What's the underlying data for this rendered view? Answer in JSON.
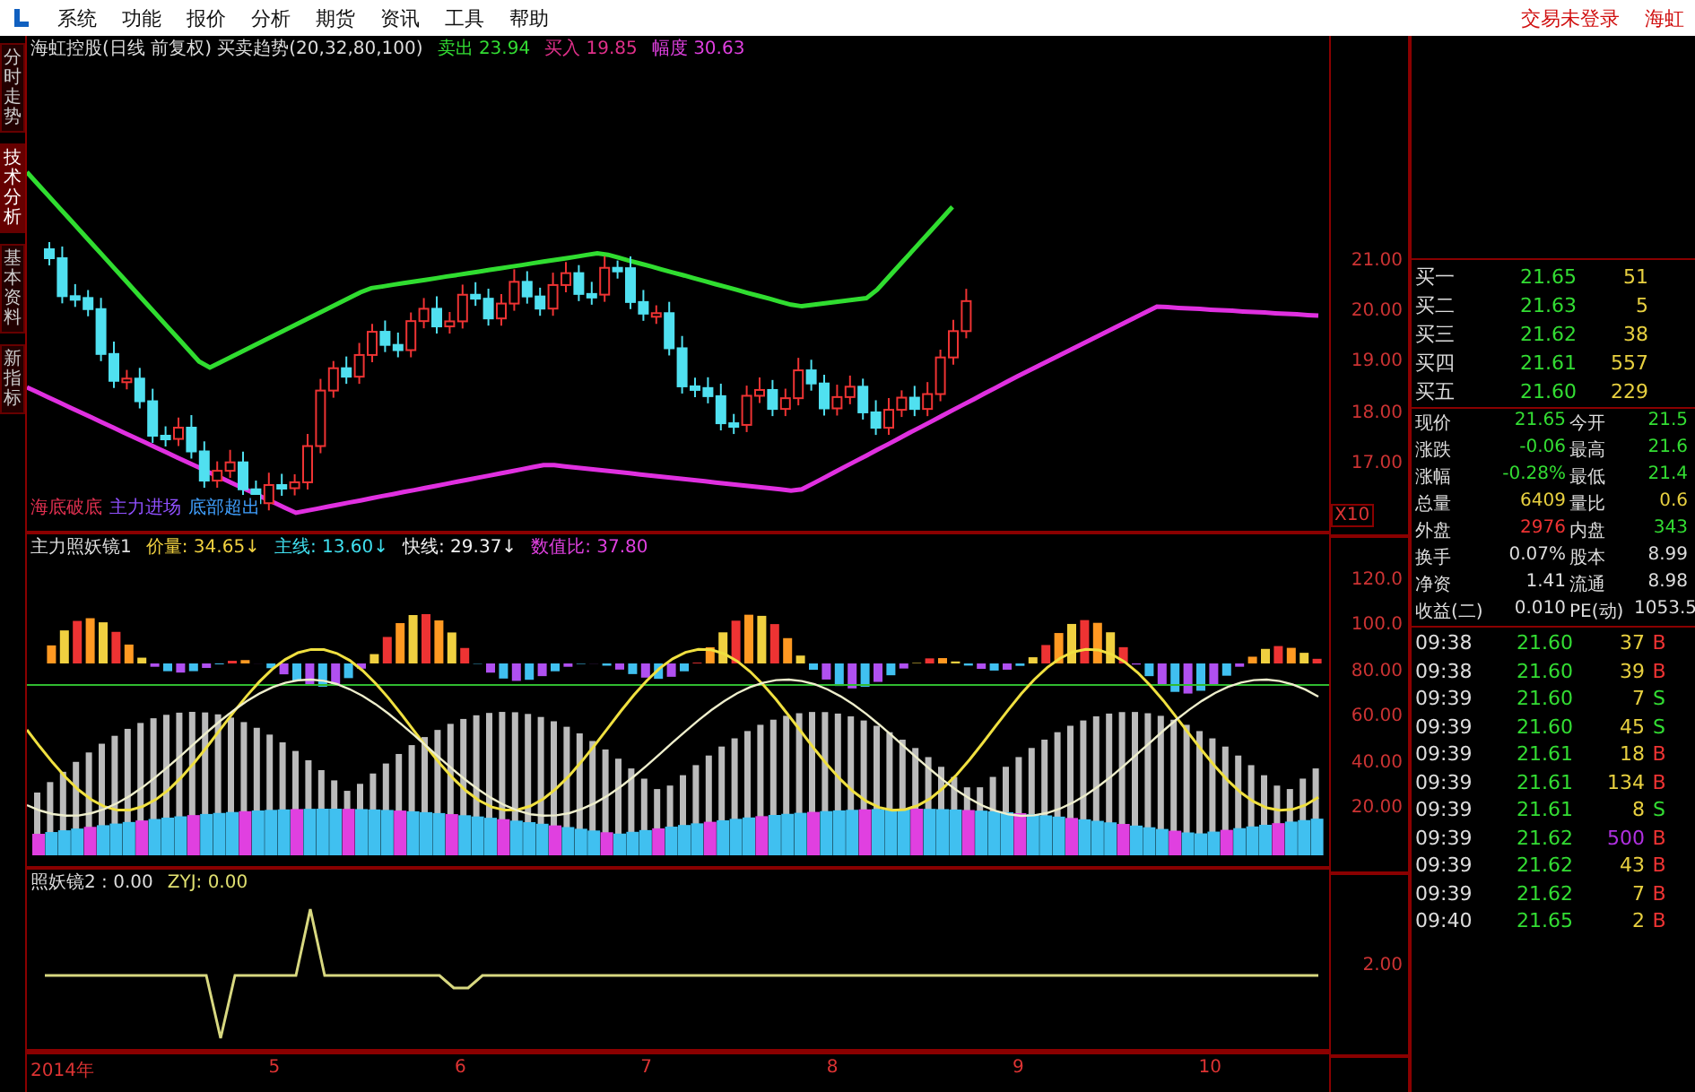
{
  "menu": {
    "items": [
      "系统",
      "功能",
      "报价",
      "分析",
      "期货",
      "资讯",
      "工具",
      "帮助"
    ],
    "login_status": "交易未登录",
    "stock_name": "海虹"
  },
  "side_tabs": [
    {
      "label": "分时走势",
      "selected": false
    },
    {
      "label": "技术分析",
      "selected": true
    },
    {
      "label": "基本资料",
      "selected": false
    },
    {
      "label": "新指标",
      "selected": false
    }
  ],
  "price_panel": {
    "title": "海虹控股(日线 前复权) 买卖趋势(20,32,80,100)",
    "readings": [
      {
        "text": "卖出 23.94",
        "color": "#33dd33"
      },
      {
        "text": "买入 19.85",
        "color": "#e0308a"
      },
      {
        "text": "幅度 30.63",
        "color": "#e040e0"
      }
    ],
    "signals": [
      {
        "text": "海底破底",
        "color": "#e03050"
      },
      {
        "text": "主力进场",
        "color": "#9050ff"
      },
      {
        "text": "底部超出",
        "color": "#40a0ff"
      }
    ],
    "axis_ticks": [
      "21.00",
      "20.00",
      "19.00",
      "18.00",
      "17.00"
    ],
    "scale": "X10"
  },
  "indicator_panel": {
    "title": "主力照妖镜1",
    "readings": [
      {
        "text": "价量: 34.65↓",
        "color": "#f0d040"
      },
      {
        "text": "主线: 13.60↓",
        "color": "#40e0f0"
      },
      {
        "text": "快线: 29.37↓",
        "color": "#f0f0f0"
      },
      {
        "text": "数值比: 37.80",
        "color": "#e040e0"
      }
    ],
    "axis_ticks": [
      "120.0",
      "100.0",
      "80.00",
      "60.00",
      "40.00",
      "20.00"
    ]
  },
  "lower_panel": {
    "readings": [
      {
        "text": "照妖镜2 : 0.00",
        "color": "#dddddd"
      },
      {
        "text": "ZYJ: 0.00",
        "color": "#e0e070"
      }
    ],
    "axis_ticks": [
      "2.00"
    ]
  },
  "x_axis": [
    "2014年",
    "5",
    "6",
    "7",
    "8",
    "9",
    "10"
  ],
  "quote": {
    "bids": [
      {
        "label": "买一",
        "price": "21.65",
        "volume": "51"
      },
      {
        "label": "买二",
        "price": "21.63",
        "volume": "5"
      },
      {
        "label": "买三",
        "price": "21.62",
        "volume": "38"
      },
      {
        "label": "买四",
        "price": "21.61",
        "volume": "557"
      },
      {
        "label": "买五",
        "price": "21.60",
        "volume": "229"
      }
    ],
    "stats": [
      {
        "label": "现价",
        "value": "21.65",
        "color": "#33dd33"
      },
      {
        "label": "今开",
        "value": "21.5",
        "color": "#33dd33"
      },
      {
        "label": "涨跌",
        "value": "-0.06",
        "color": "#33dd33"
      },
      {
        "label": "最高",
        "value": "21.6",
        "color": "#33dd33"
      },
      {
        "label": "涨幅",
        "value": "-0.28%",
        "color": "#33dd33"
      },
      {
        "label": "最低",
        "value": "21.4",
        "color": "#33dd33"
      },
      {
        "label": "总量",
        "value": "6409",
        "color": "#e8d040"
      },
      {
        "label": "量比",
        "value": "0.6",
        "color": "#e8d040"
      },
      {
        "label": "外盘",
        "value": "2976",
        "color": "#ee3333"
      },
      {
        "label": "内盘",
        "value": "343",
        "color": "#33dd33"
      },
      {
        "label": "换手",
        "value": "0.07%",
        "color": "#dddddd"
      },
      {
        "label": "股本",
        "value": "8.99",
        "color": "#dddddd"
      },
      {
        "label": "净资",
        "value": "1.41",
        "color": "#dddddd"
      },
      {
        "label": "流通",
        "value": "8.98",
        "color": "#dddddd"
      },
      {
        "label": "收益(二)",
        "value": "0.010",
        "color": "#dddddd"
      },
      {
        "label": "PE(动)",
        "value": "1053.5",
        "color": "#dddddd"
      }
    ],
    "ticks": [
      {
        "time": "09:38",
        "price": "21.60",
        "volume": {
          "text": "37",
          "color": "#e8d040"
        },
        "side": {
          "text": "B",
          "color": "#ee3333"
        }
      },
      {
        "time": "09:38",
        "price": "21.60",
        "volume": {
          "text": "39",
          "color": "#e8d040"
        },
        "side": {
          "text": "B",
          "color": "#ee3333"
        }
      },
      {
        "time": "09:39",
        "price": "21.60",
        "volume": {
          "text": "7",
          "color": "#e8d040"
        },
        "side": {
          "text": "S",
          "color": "#33dd33"
        }
      },
      {
        "time": "09:39",
        "price": "21.60",
        "volume": {
          "text": "45",
          "color": "#e8d040"
        },
        "side": {
          "text": "S",
          "color": "#33dd33"
        }
      },
      {
        "time": "09:39",
        "price": "21.61",
        "volume": {
          "text": "18",
          "color": "#e8d040"
        },
        "side": {
          "text": "B",
          "color": "#ee3333"
        }
      },
      {
        "time": "09:39",
        "price": "21.61",
        "volume": {
          "text": "134",
          "color": "#e8d040"
        },
        "side": {
          "text": "B",
          "color": "#ee3333"
        }
      },
      {
        "time": "09:39",
        "price": "21.61",
        "volume": {
          "text": "8",
          "color": "#e8d040"
        },
        "side": {
          "text": "S",
          "color": "#33dd33"
        }
      },
      {
        "time": "09:39",
        "price": "21.62",
        "volume": {
          "text": "500",
          "color": "#b030e0"
        },
        "side": {
          "text": "B",
          "color": "#ee3333"
        }
      },
      {
        "time": "09:39",
        "price": "21.62",
        "volume": {
          "text": "43",
          "color": "#e8d040"
        },
        "side": {
          "text": "B",
          "color": "#ee3333"
        }
      },
      {
        "time": "09:39",
        "price": "21.62",
        "volume": {
          "text": "7",
          "color": "#e8d040"
        },
        "side": {
          "text": "B",
          "color": "#ee3333"
        }
      },
      {
        "time": "09:40",
        "price": "21.65",
        "volume": {
          "text": "2",
          "color": "#e8d040"
        },
        "side": {
          "text": "B",
          "color": "#ee3333"
        }
      }
    ]
  }
}
